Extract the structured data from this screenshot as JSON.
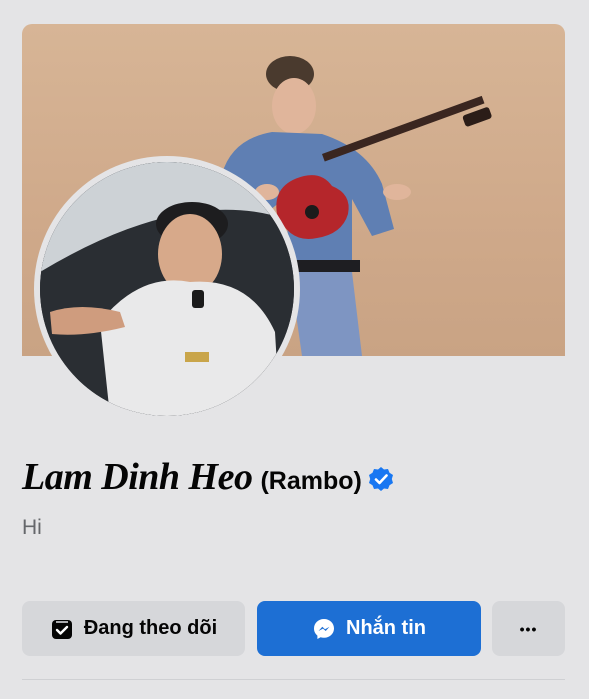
{
  "profile": {
    "name": "Lam Dinh Heo",
    "alt_name": "(Rambo)",
    "verified": true,
    "bio": "Hi"
  },
  "actions": {
    "follow_label": "Đang theo dõi",
    "message_label": "Nhắn tin",
    "more_label": "•••"
  },
  "icons": {
    "verified": "verified-badge-icon",
    "follow": "following-check-icon",
    "message": "messenger-icon",
    "more": "more-options-icon"
  },
  "colors": {
    "background": "#e4e4e6",
    "primary_button": "#1d6fd4",
    "secondary_button": "#d6d7da",
    "verified_badge": "#1877f2"
  }
}
